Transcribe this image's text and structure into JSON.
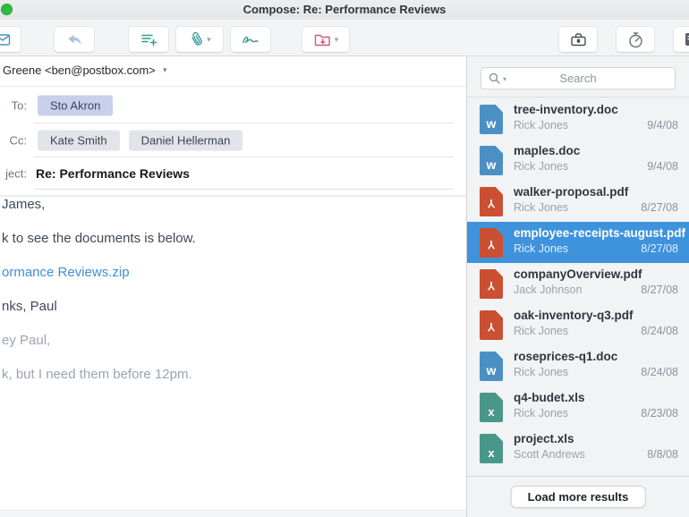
{
  "window": {
    "title": "Compose: Re: Performance Reviews"
  },
  "toolbar": {
    "icons": [
      "send",
      "reply",
      "add-list",
      "attach",
      "signature",
      "file-folder",
      "briefcase",
      "timer",
      "notes"
    ]
  },
  "compose": {
    "from": {
      "value": "Greene <ben@postbox.com>"
    },
    "to": {
      "label": "To:",
      "recipients": [
        "Sto Akron"
      ]
    },
    "cc": {
      "label": "Cc:",
      "recipients": [
        "Kate Smith",
        "Daniel Hellerman"
      ]
    },
    "subject": {
      "label": "ject:",
      "value": "Re: Performance Reviews"
    },
    "body": {
      "lines": [
        {
          "text": "James,",
          "style": "normal"
        },
        {
          "text": "k to see the documents is below.",
          "style": "normal"
        },
        {
          "text": "ormance Reviews.zip",
          "style": "link"
        },
        {
          "text": "nks, Paul",
          "style": "normal"
        },
        {
          "text": "ey Paul,",
          "style": "quoted"
        },
        {
          "text": "k, but I need them before 12pm.",
          "style": "quoted"
        }
      ]
    }
  },
  "sidebar": {
    "search": {
      "placeholder": "Search"
    },
    "files": [
      {
        "name": "tree-inventory.doc",
        "sender": "Rick Jones",
        "date": "9/4/08",
        "type": "doc",
        "selected": false
      },
      {
        "name": "maples.doc",
        "sender": "Rick Jones",
        "date": "9/4/08",
        "type": "doc",
        "selected": false
      },
      {
        "name": "walker-proposal.pdf",
        "sender": "Rick Jones",
        "date": "8/27/08",
        "type": "pdf",
        "selected": false
      },
      {
        "name": "employee-receipts-august.pdf",
        "sender": "Rick Jones",
        "date": "8/27/08",
        "type": "pdf",
        "selected": true
      },
      {
        "name": "companyOverview.pdf",
        "sender": "Jack Johnson",
        "date": "8/27/08",
        "type": "pdf",
        "selected": false
      },
      {
        "name": "oak-inventory-q3.pdf",
        "sender": "Rick Jones",
        "date": "8/24/08",
        "type": "pdf",
        "selected": false
      },
      {
        "name": "roseprices-q1.doc",
        "sender": "Rick Jones",
        "date": "8/24/08",
        "type": "doc",
        "selected": false
      },
      {
        "name": "q4-budet.xls",
        "sender": "Rick Jones",
        "date": "8/23/08",
        "type": "xls",
        "selected": false
      },
      {
        "name": "project.xls",
        "sender": "Scott Andrews",
        "date": "8/8/08",
        "type": "xls",
        "selected": false
      }
    ],
    "load_more_label": "Load more results"
  },
  "colors": {
    "selected_row": "#3e93dc",
    "doc_icon": "#4b90c4",
    "pdf_icon": "#cb4f31",
    "xls_icon": "#49978a",
    "link": "#3e8ed8",
    "accent_teal": "#2f9d8a",
    "folder_pink": "#cf5b74"
  }
}
